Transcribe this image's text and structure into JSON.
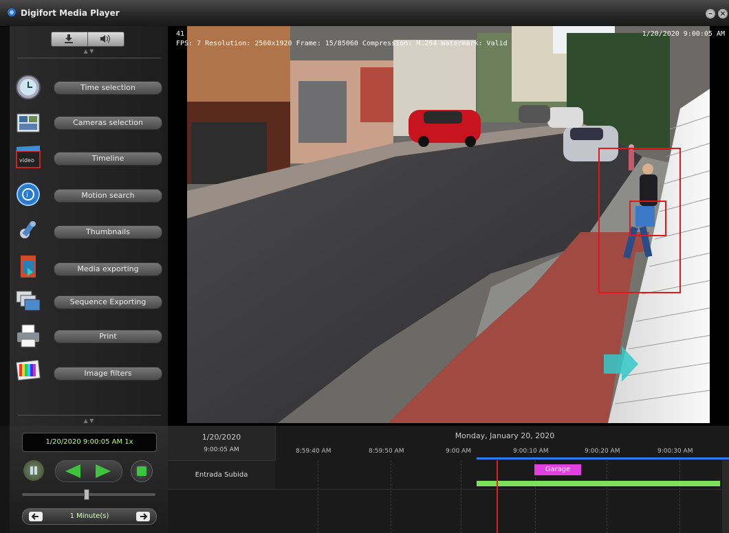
{
  "window": {
    "title": "Digifort Media Player"
  },
  "sidebar": {
    "items": [
      {
        "label": "Time selection",
        "icon": "clock-icon"
      },
      {
        "label": "Cameras selection",
        "icon": "cameras-icon"
      },
      {
        "label": "Timeline",
        "icon": "timeline-icon"
      },
      {
        "label": "Motion search",
        "icon": "motion-search-icon"
      },
      {
        "label": "Thumbnails",
        "icon": "thumbnails-icon"
      },
      {
        "label": "Media exporting",
        "icon": "media-export-icon"
      },
      {
        "label": "Sequence Exporting",
        "icon": "sequence-export-icon"
      },
      {
        "label": "Print",
        "icon": "printer-icon"
      },
      {
        "label": "Image filters",
        "icon": "image-filters-icon"
      }
    ]
  },
  "video": {
    "frame_num": "41",
    "info_line": "FPS: 7   Resolution: 2560x1920   Frame: 15/85060   Compression: H.264   Watermark: Valid",
    "timestamp": "1/20/2020 9:00:05 AM"
  },
  "player": {
    "display": "1/20/2020 9:00:05 AM 1x",
    "interval": "1 Minute(s)"
  },
  "timeline": {
    "date": "1/20/2020",
    "time": "9:00:05 AM",
    "day_header": "Monday, January 20, 2020",
    "ticks": [
      "8:59:40 AM",
      "8:59:50 AM",
      "9:00 AM",
      "9:00:10 AM",
      "9:00:20 AM",
      "9:00:30 AM"
    ],
    "camera": "Entrada Subida",
    "event_label": "Garage",
    "colors": {
      "recording": "#7be05a",
      "event": "#e040e0",
      "cursor": "#e02020",
      "range": "#2a7fff"
    }
  }
}
